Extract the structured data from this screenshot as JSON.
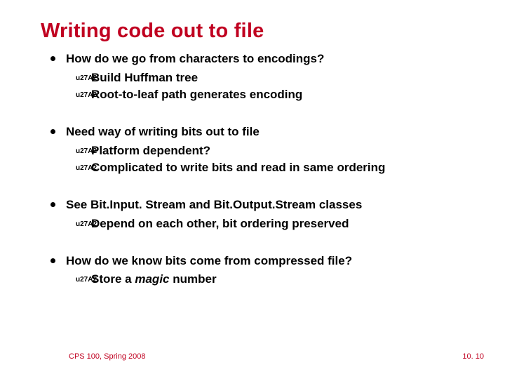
{
  "title": "Writing code out to file",
  "bullets": [
    {
      "text": "How do we go from characters to encodings?",
      "sub": [
        "Build Huffman tree",
        "Root-to-leaf path generates encoding"
      ]
    },
    {
      "text": "Need way of writing bits out to file",
      "sub": [
        "Platform dependent?",
        "Complicated to write bits and read in same ordering"
      ]
    },
    {
      "text": "See Bit.Input. Stream and Bit.Output.Stream classes",
      "sub": [
        "Depend on each other, bit ordering preserved"
      ]
    },
    {
      "text_pre": "How do we know bits come from compressed file?",
      "sub_special": {
        "pre": "Store a ",
        "em": "magic",
        "post": " number"
      }
    }
  ],
  "footer": {
    "left": "CPS 100, Spring 2008",
    "right": "10. 10"
  }
}
